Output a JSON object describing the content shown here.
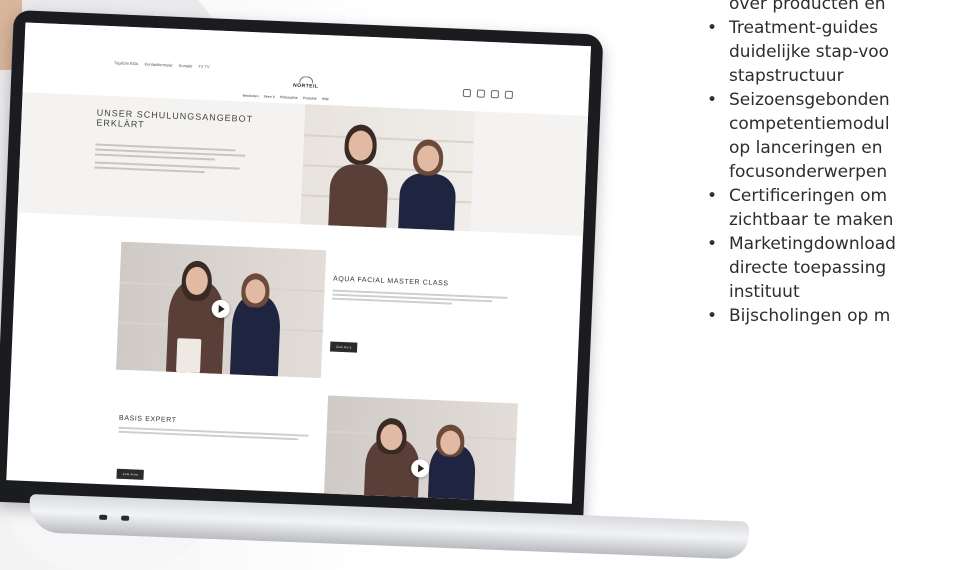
{
  "website": {
    "utility_links": [
      "Tägliche BOA",
      "Kontaktformular",
      "Kontakt",
      "TV TV"
    ],
    "logo": "NORTEIL",
    "main_menu": [
      "Neuheiten",
      "Seen It",
      "Philosophie",
      "Produkte",
      "Hilfe"
    ],
    "hero_title": "Unser Schulungsangebot erklärt",
    "section1_title": "Aqua Facial Master Class",
    "section1_button": "Zum Kurs",
    "section2_title": "Basis Expert",
    "section2_button": "Zum Kurs"
  },
  "bullets": {
    "line0": "over producten en",
    "item1_line1": "Treatment-guides",
    "item1_line2": "duidelijke stap-voo",
    "item1_line3": "stapstructuur",
    "item2_line1": "Seizoensgebonden",
    "item2_line2": "competentiemodul",
    "item2_line3": "op lanceringen en",
    "item2_line4": "focusonderwerpen",
    "item3_line1": "Certificeringen om",
    "item3_line2": "zichtbaar te maken",
    "item4_line1": "Marketingdownload",
    "item4_line2": "directe toepassing",
    "item4_line3": "instituut",
    "item5_line1": "Bijscholingen op m"
  }
}
